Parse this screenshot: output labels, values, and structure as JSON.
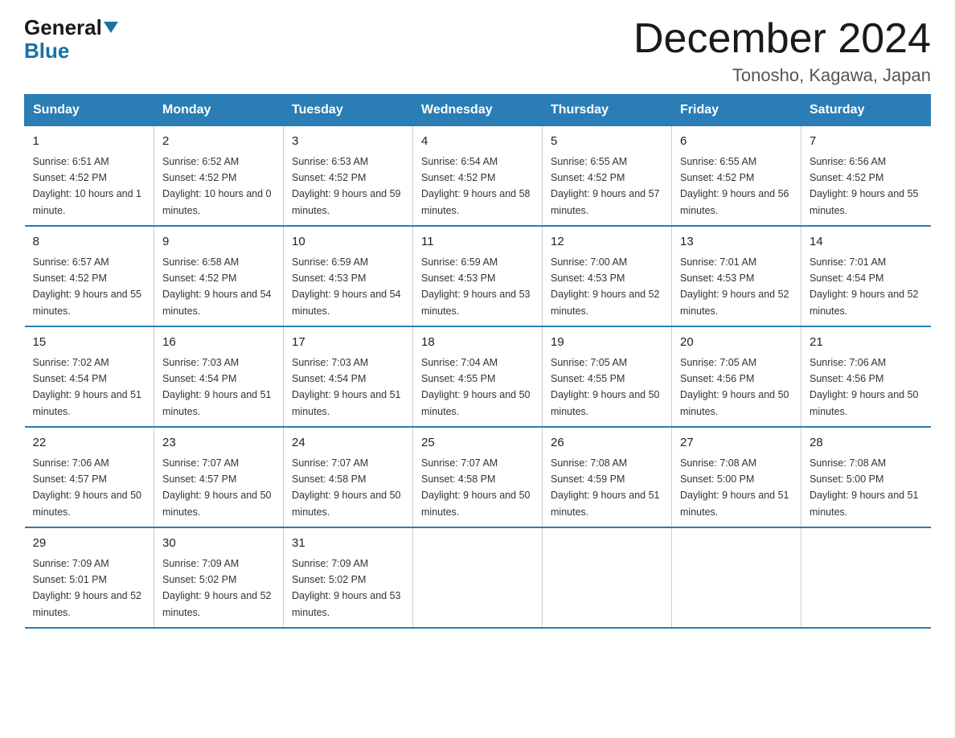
{
  "logo": {
    "general": "General",
    "blue": "Blue"
  },
  "title": "December 2024",
  "location": "Tonosho, Kagawa, Japan",
  "weekdays": [
    "Sunday",
    "Monday",
    "Tuesday",
    "Wednesday",
    "Thursday",
    "Friday",
    "Saturday"
  ],
  "weeks": [
    [
      {
        "day": "1",
        "sunrise": "6:51 AM",
        "sunset": "4:52 PM",
        "daylight": "10 hours and 1 minute."
      },
      {
        "day": "2",
        "sunrise": "6:52 AM",
        "sunset": "4:52 PM",
        "daylight": "10 hours and 0 minutes."
      },
      {
        "day": "3",
        "sunrise": "6:53 AM",
        "sunset": "4:52 PM",
        "daylight": "9 hours and 59 minutes."
      },
      {
        "day": "4",
        "sunrise": "6:54 AM",
        "sunset": "4:52 PM",
        "daylight": "9 hours and 58 minutes."
      },
      {
        "day": "5",
        "sunrise": "6:55 AM",
        "sunset": "4:52 PM",
        "daylight": "9 hours and 57 minutes."
      },
      {
        "day": "6",
        "sunrise": "6:55 AM",
        "sunset": "4:52 PM",
        "daylight": "9 hours and 56 minutes."
      },
      {
        "day": "7",
        "sunrise": "6:56 AM",
        "sunset": "4:52 PM",
        "daylight": "9 hours and 55 minutes."
      }
    ],
    [
      {
        "day": "8",
        "sunrise": "6:57 AM",
        "sunset": "4:52 PM",
        "daylight": "9 hours and 55 minutes."
      },
      {
        "day": "9",
        "sunrise": "6:58 AM",
        "sunset": "4:52 PM",
        "daylight": "9 hours and 54 minutes."
      },
      {
        "day": "10",
        "sunrise": "6:59 AM",
        "sunset": "4:53 PM",
        "daylight": "9 hours and 54 minutes."
      },
      {
        "day": "11",
        "sunrise": "6:59 AM",
        "sunset": "4:53 PM",
        "daylight": "9 hours and 53 minutes."
      },
      {
        "day": "12",
        "sunrise": "7:00 AM",
        "sunset": "4:53 PM",
        "daylight": "9 hours and 52 minutes."
      },
      {
        "day": "13",
        "sunrise": "7:01 AM",
        "sunset": "4:53 PM",
        "daylight": "9 hours and 52 minutes."
      },
      {
        "day": "14",
        "sunrise": "7:01 AM",
        "sunset": "4:54 PM",
        "daylight": "9 hours and 52 minutes."
      }
    ],
    [
      {
        "day": "15",
        "sunrise": "7:02 AM",
        "sunset": "4:54 PM",
        "daylight": "9 hours and 51 minutes."
      },
      {
        "day": "16",
        "sunrise": "7:03 AM",
        "sunset": "4:54 PM",
        "daylight": "9 hours and 51 minutes."
      },
      {
        "day": "17",
        "sunrise": "7:03 AM",
        "sunset": "4:54 PM",
        "daylight": "9 hours and 51 minutes."
      },
      {
        "day": "18",
        "sunrise": "7:04 AM",
        "sunset": "4:55 PM",
        "daylight": "9 hours and 50 minutes."
      },
      {
        "day": "19",
        "sunrise": "7:05 AM",
        "sunset": "4:55 PM",
        "daylight": "9 hours and 50 minutes."
      },
      {
        "day": "20",
        "sunrise": "7:05 AM",
        "sunset": "4:56 PM",
        "daylight": "9 hours and 50 minutes."
      },
      {
        "day": "21",
        "sunrise": "7:06 AM",
        "sunset": "4:56 PM",
        "daylight": "9 hours and 50 minutes."
      }
    ],
    [
      {
        "day": "22",
        "sunrise": "7:06 AM",
        "sunset": "4:57 PM",
        "daylight": "9 hours and 50 minutes."
      },
      {
        "day": "23",
        "sunrise": "7:07 AM",
        "sunset": "4:57 PM",
        "daylight": "9 hours and 50 minutes."
      },
      {
        "day": "24",
        "sunrise": "7:07 AM",
        "sunset": "4:58 PM",
        "daylight": "9 hours and 50 minutes."
      },
      {
        "day": "25",
        "sunrise": "7:07 AM",
        "sunset": "4:58 PM",
        "daylight": "9 hours and 50 minutes."
      },
      {
        "day": "26",
        "sunrise": "7:08 AM",
        "sunset": "4:59 PM",
        "daylight": "9 hours and 51 minutes."
      },
      {
        "day": "27",
        "sunrise": "7:08 AM",
        "sunset": "5:00 PM",
        "daylight": "9 hours and 51 minutes."
      },
      {
        "day": "28",
        "sunrise": "7:08 AM",
        "sunset": "5:00 PM",
        "daylight": "9 hours and 51 minutes."
      }
    ],
    [
      {
        "day": "29",
        "sunrise": "7:09 AM",
        "sunset": "5:01 PM",
        "daylight": "9 hours and 52 minutes."
      },
      {
        "day": "30",
        "sunrise": "7:09 AM",
        "sunset": "5:02 PM",
        "daylight": "9 hours and 52 minutes."
      },
      {
        "day": "31",
        "sunrise": "7:09 AM",
        "sunset": "5:02 PM",
        "daylight": "9 hours and 53 minutes."
      },
      null,
      null,
      null,
      null
    ]
  ]
}
